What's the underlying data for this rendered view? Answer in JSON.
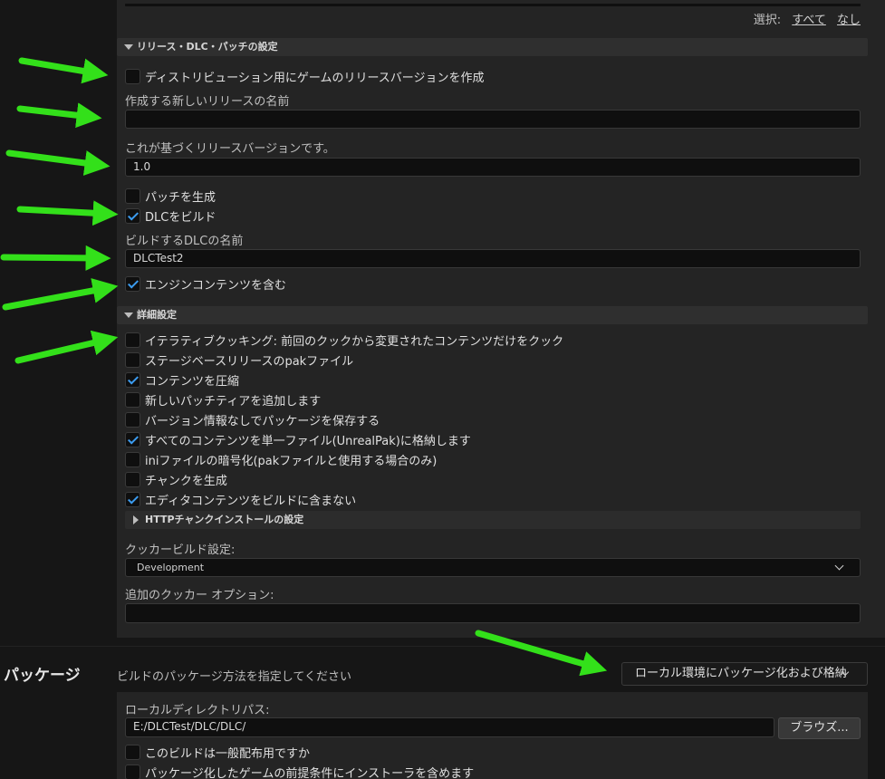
{
  "top": {
    "select_label": "選択:",
    "all_link": "すべて",
    "none_link": "なし"
  },
  "release_section": {
    "header": "リリース・DLC・パッチの設定",
    "create_release_checkbox": {
      "label": "ディストリビューション用にゲームのリリースバージョンを作成",
      "checked": false
    },
    "new_release_name_label": "作成する新しいリリースの名前",
    "new_release_name_value": "",
    "based_on_release_label": "これが基づくリリースバージョンです。",
    "based_on_release_value": "1.0",
    "generate_patch_checkbox": {
      "label": "パッチを生成",
      "checked": false
    },
    "build_dlc_checkbox": {
      "label": "DLCをビルド",
      "checked": true
    },
    "dlc_name_label": "ビルドするDLCの名前",
    "dlc_name_value": "DLCTest2",
    "include_engine_checkbox": {
      "label": "エンジンコンテンツを含む",
      "checked": true
    }
  },
  "advanced_section": {
    "header": "詳細設定",
    "options": [
      {
        "label": "イテラティブクッキング: 前回のクックから変更されたコンテンツだけをクック",
        "checked": false
      },
      {
        "label": "ステージベースリリースのpakファイル",
        "checked": false
      },
      {
        "label": "コンテンツを圧縮",
        "checked": true
      },
      {
        "label": "新しいパッチティアを追加します",
        "checked": false
      },
      {
        "label": "バージョン情報なしでパッケージを保存する",
        "checked": false
      },
      {
        "label": "すべてのコンテンツを単一ファイル(UnrealPak)に格納します",
        "checked": true
      },
      {
        "label": "iniファイルの暗号化(pakファイルと使用する場合のみ)",
        "checked": false
      },
      {
        "label": "チャンクを生成",
        "checked": false
      },
      {
        "label": "エディタコンテンツをビルドに含まない",
        "checked": true
      }
    ],
    "http_chunk_header": "HTTPチャンクインストールの設定",
    "cooker_build_label": "クッカービルド設定:",
    "cooker_build_value": "Development",
    "extra_cooker_label": "追加のクッカー オプション:",
    "extra_cooker_value": ""
  },
  "package_section": {
    "title": "パッケージ",
    "description": "ビルドのパッケージ方法を指定してください",
    "method_value": "ローカル環境にパッケージ化および格納",
    "local_dir_label": "ローカルディレクトリパス:",
    "local_dir_value": "E:/DLCTest/DLC/DLC/",
    "browse_button": "ブラウズ...",
    "distribution_checkbox": {
      "label": "このビルドは一般配布用ですか",
      "checked": false
    },
    "prereq_checkbox": {
      "label": "パッケージ化したゲームの前提条件にインストーラを含めます",
      "checked": false
    }
  },
  "colors": {
    "arrow": "#33e01a",
    "checkmark": "#3c9cf0",
    "panel_bg": "#242424",
    "page_bg": "#161616"
  }
}
